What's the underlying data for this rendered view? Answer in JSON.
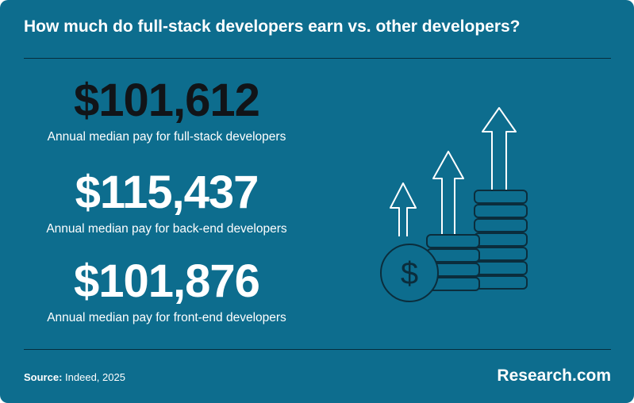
{
  "header": {
    "title": "How much do full-stack developers earn vs. other developers?"
  },
  "stats": [
    {
      "value": "$101,612",
      "label": "Annual median pay for full-stack developers"
    },
    {
      "value": "$115,437",
      "label": "Annual median pay for back-end developers"
    },
    {
      "value": "$101,876",
      "label": "Annual median pay for front-end developers"
    }
  ],
  "illustration": {
    "icon": "growth-coins-arrows-icon",
    "coin_symbol": "$"
  },
  "footer": {
    "source_label": "Source:",
    "source_text": "Indeed, 2025",
    "brand": "Research.com"
  },
  "colors": {
    "background": "#0d6d8e",
    "highlight_value": "#111418",
    "text": "#ffffff",
    "icon_stroke": "#0b2d3c"
  }
}
